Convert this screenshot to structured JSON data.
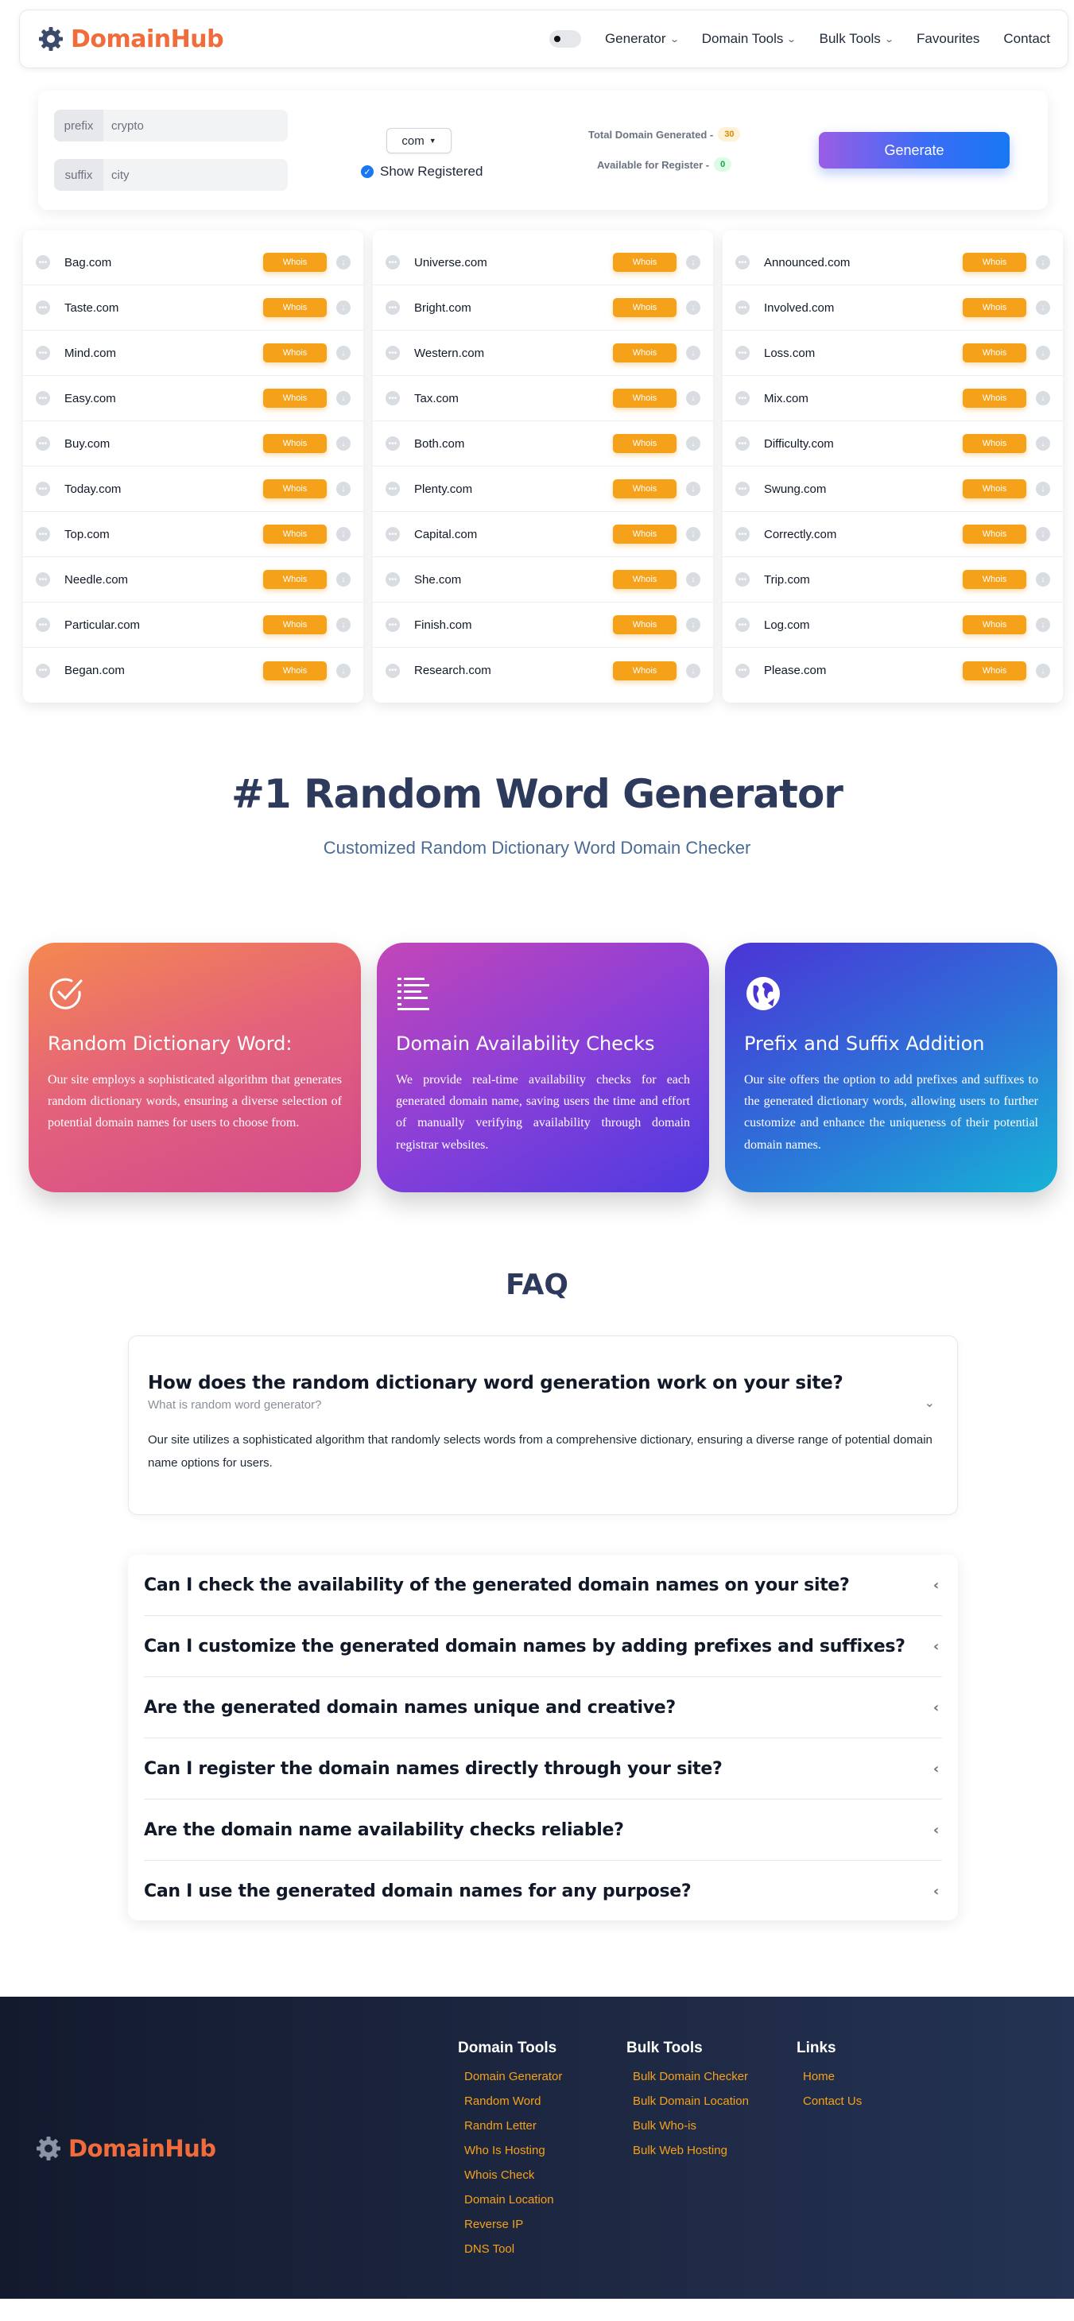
{
  "brand": {
    "name": "DomainHub",
    "color": "#f26b3a"
  },
  "nav": {
    "items": [
      {
        "label": "Generator",
        "dropdown": true
      },
      {
        "label": "Domain Tools",
        "dropdown": true
      },
      {
        "label": "Bulk Tools",
        "dropdown": true
      },
      {
        "label": "Favourites",
        "dropdown": false
      },
      {
        "label": "Contact",
        "dropdown": false
      }
    ]
  },
  "form": {
    "prefix_label": "prefix",
    "prefix_value": "crypto",
    "suffix_label": "suffix",
    "suffix_value": "city",
    "tld_selected": "com",
    "show_registered_label": "Show Registered",
    "show_registered_checked": true,
    "total_label": "Total Domain Generated -",
    "total_value": "30",
    "available_label": "Available for Register -",
    "available_value": "0",
    "generate_label": "Generate"
  },
  "whois_label": "Whois",
  "domain_columns": [
    [
      "Bag.com",
      "Taste.com",
      "Mind.com",
      "Easy.com",
      "Buy.com",
      "Today.com",
      "Top.com",
      "Needle.com",
      "Particular.com",
      "Began.com"
    ],
    [
      "Universe.com",
      "Bright.com",
      "Western.com",
      "Tax.com",
      "Both.com",
      "Plenty.com",
      "Capital.com",
      "She.com",
      "Finish.com",
      "Research.com"
    ],
    [
      "Announced.com",
      "Involved.com",
      "Loss.com",
      "Mix.com",
      "Difficulty.com",
      "Swung.com",
      "Correctly.com",
      "Trip.com",
      "Log.com",
      "Please.com"
    ]
  ],
  "hero": {
    "title": "#1 Random Word Generator",
    "subtitle": "Customized Random Dictionary Word Domain Checker"
  },
  "features": [
    {
      "icon": "check-circle-icon",
      "title": "Random Dictionary Word:",
      "text": "Our site employs a sophisticated algorithm that generates random dictionary words, ensuring a diverse selection of potential domain names for users to choose from."
    },
    {
      "icon": "list-icon",
      "title": "Domain Availability Checks",
      "text": "We provide real-time availability checks for each generated domain name, saving users the time and effort of manually verifying availability through domain registrar websites."
    },
    {
      "icon": "globe-icon",
      "title": "Prefix and Suffix Addition",
      "text": "Our site offers the option to add prefixes and suffixes to the generated dictionary words, allowing users to further customize and enhance the uniqueness of their potential domain names."
    }
  ],
  "faq": {
    "title": "FAQ",
    "open": {
      "question": "How does the random dictionary word generation work on your site?",
      "subtitle": "What is random word generator?",
      "answer": "Our site utilizes a sophisticated algorithm that randomly selects words from a comprehensive dictionary, ensuring a diverse range of potential domain name options for users."
    },
    "items": [
      "Can I check the availability of the generated domain names on your site?",
      "Can I customize the generated domain names by adding prefixes and suffixes?",
      "Are the generated domain names unique and creative?",
      "Can I register the domain names directly through your site?",
      "Are the domain name availability checks reliable?",
      "Can I use the generated domain names for any purpose?"
    ]
  },
  "footer": {
    "brand": "DomainHub",
    "columns": [
      {
        "title": "Domain Tools",
        "links": [
          "Domain Generator",
          "Random Word",
          "Randm Letter",
          "Who Is Hosting",
          "Whois Check",
          "Domain Location",
          "Reverse IP",
          "DNS Tool"
        ]
      },
      {
        "title": "Bulk Tools",
        "links": [
          "Bulk Domain Checker",
          "Bulk Domain Location",
          "Bulk Who-is",
          "Bulk Web Hosting"
        ]
      },
      {
        "title": "Links",
        "links": [
          "Home",
          "Contact Us"
        ]
      }
    ]
  }
}
